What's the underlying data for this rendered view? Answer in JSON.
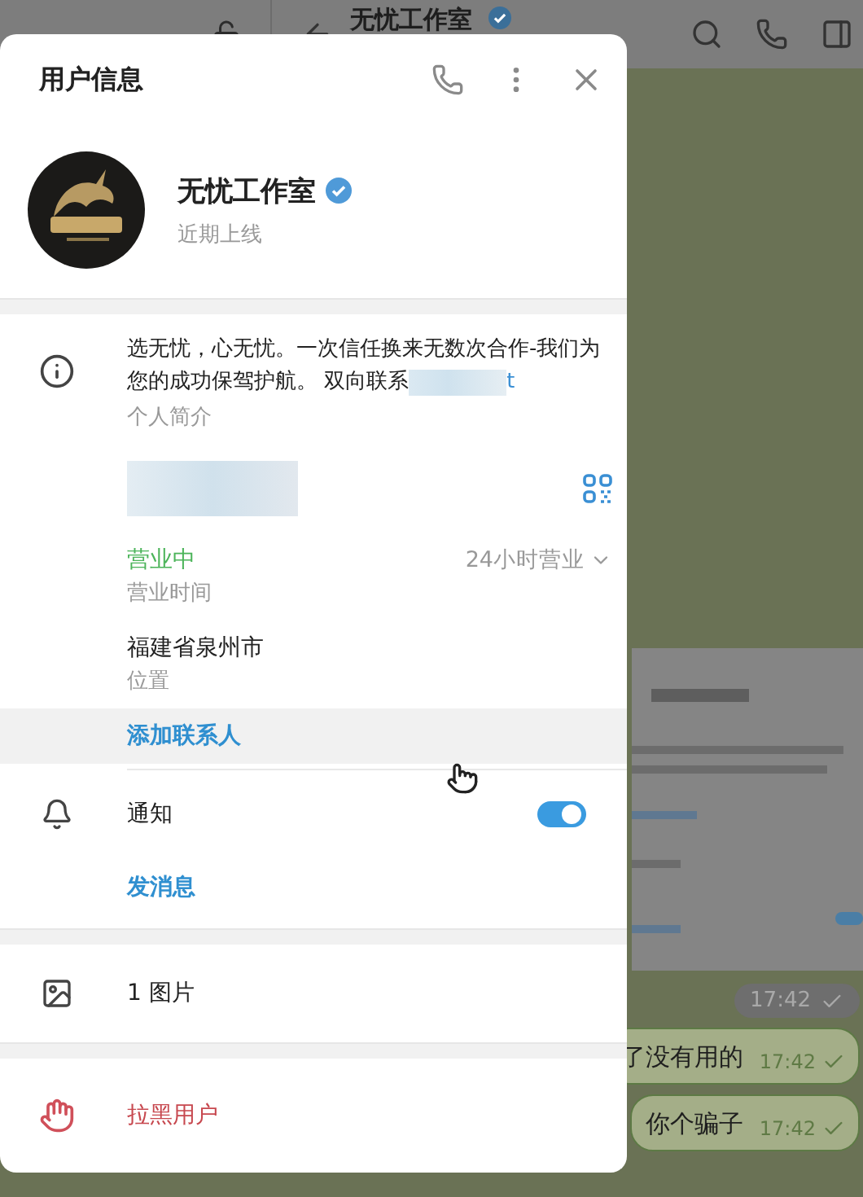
{
  "chat": {
    "title": "无忧工作室",
    "verified": true,
    "messages": [
      {
        "time": "17:42"
      },
      {
        "kind": "text",
        "text": "了没有用的",
        "time": "17:42"
      },
      {
        "kind": "text",
        "text": "你个骗子",
        "time": "17:42"
      }
    ]
  },
  "dialog": {
    "title": "用户信息",
    "profile": {
      "name": "无忧工作室",
      "verified": true,
      "status": "近期上线"
    },
    "bio": {
      "text": "选无忧，心无忧。一次信任换来无数次合作-我们为您的成功保驾护航。 双向联系",
      "link_tail": "t",
      "label": "个人简介"
    },
    "username": {
      "redacted": true
    },
    "hours": {
      "status": "营业中",
      "open": true,
      "schedule": "24小时营业",
      "label": "营业时间"
    },
    "location": {
      "value": "福建省泉州市",
      "label": "位置"
    },
    "add_contact": {
      "label": "添加联系人",
      "hovered": true
    },
    "notifications": {
      "label": "通知",
      "on": true
    },
    "send_message": "发消息",
    "media": [
      {
        "text": "1 图片"
      }
    ],
    "block": "拉黑用户"
  }
}
